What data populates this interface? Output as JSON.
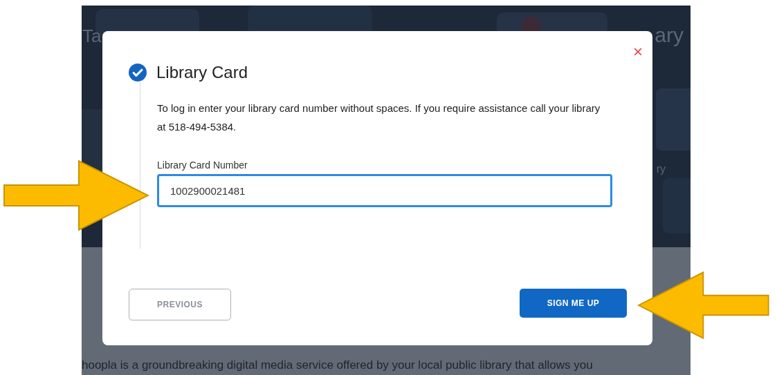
{
  "background_page": {
    "heading_left": "Ta",
    "heading_right": "ary",
    "side_text": "ry",
    "intro": "hoopla is a groundbreaking digital media service offered by your local public library that allows you"
  },
  "dialog": {
    "title": "Library Card",
    "completed": true,
    "close": "×",
    "instructions": "To log in enter your library card number without spaces. If you require assistance call your library at 518-494-5384.",
    "field": {
      "label": "Library Card Number",
      "value": "1002900021481",
      "focused": true
    },
    "buttons": [
      {
        "label": "PREVIOUS",
        "kind": "secondary"
      },
      {
        "label": "SIGN ME UP",
        "kind": "primary"
      }
    ]
  },
  "annotations": [
    {
      "kind": "arrow-right"
    },
    {
      "kind": "arrow-left"
    }
  ]
}
